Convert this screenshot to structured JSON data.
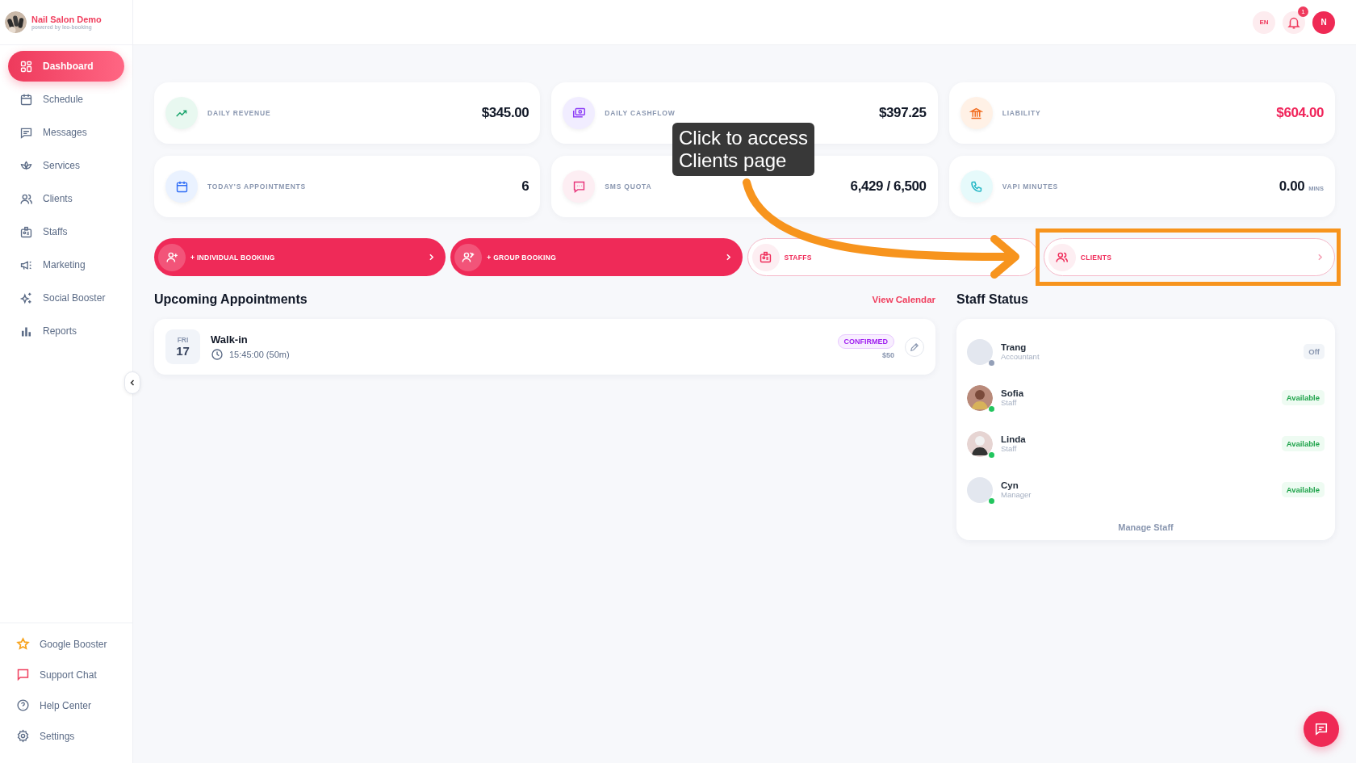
{
  "brand": {
    "name": "Nail Salon Demo",
    "tagline": "powered by leo-booking"
  },
  "sidebar": {
    "items": [
      {
        "label": "Dashboard",
        "selected": true
      },
      {
        "label": "Schedule",
        "selected": false
      },
      {
        "label": "Messages",
        "selected": false
      },
      {
        "label": "Services",
        "selected": false
      },
      {
        "label": "Clients",
        "selected": false
      },
      {
        "label": "Staffs",
        "selected": false
      },
      {
        "label": "Marketing",
        "selected": false
      },
      {
        "label": "Social Booster",
        "selected": false
      },
      {
        "label": "Reports",
        "selected": false
      }
    ],
    "bottom_items": [
      {
        "label": "Google Booster"
      },
      {
        "label": "Support Chat"
      },
      {
        "label": "Help Center"
      },
      {
        "label": "Settings"
      }
    ]
  },
  "topbar": {
    "language": "EN",
    "notification_count": "1",
    "user_initial": "N"
  },
  "stats": [
    {
      "label": "DAILY REVENUE",
      "value": "$345.00",
      "highlight": false
    },
    {
      "label": "DAILY CASHFLOW",
      "value": "$397.25",
      "highlight": false
    },
    {
      "label": "LIABILITY",
      "value": "$604.00",
      "highlight": true
    },
    {
      "label": "TODAY'S APPOINTMENTS",
      "value": "6",
      "highlight": false
    },
    {
      "label": "SMS QUOTA",
      "value": "6,429 / 6,500",
      "highlight": false
    },
    {
      "label": "VAPI MINUTES",
      "value": "0.00",
      "unit": "MINS",
      "highlight": false
    }
  ],
  "quick_actions": [
    {
      "label": "+ INDIVIDUAL BOOKING",
      "kind": "primary",
      "highlighted": false
    },
    {
      "label": "+ GROUP BOOKING",
      "kind": "primary",
      "highlighted": false
    },
    {
      "label": "STAFFS",
      "kind": "outline",
      "highlighted": false
    },
    {
      "label": "CLIENTS",
      "kind": "outline",
      "highlighted": true
    }
  ],
  "callout": {
    "text": "Click to access\nClients page"
  },
  "appointments": {
    "title": "Upcoming Appointments",
    "link": "View Calendar",
    "items": [
      {
        "day": "FRI",
        "date": "17",
        "title": "Walk-in",
        "time": "15:45:00 (50m)",
        "status": "CONFIRMED",
        "price": "$50"
      }
    ]
  },
  "staff_status": {
    "title": "Staff Status",
    "footer": "Manage Staff",
    "staff": [
      {
        "name": "Trang",
        "role": "Accountant",
        "status": "Off",
        "available": false,
        "photo": false
      },
      {
        "name": "Sofia",
        "role": "Staff",
        "status": "Available",
        "available": true,
        "photo": true
      },
      {
        "name": "Linda",
        "role": "Staff",
        "status": "Available",
        "available": true,
        "photo": true
      },
      {
        "name": "Cyn",
        "role": "Manager",
        "status": "Available",
        "available": true,
        "photo": false
      }
    ]
  }
}
